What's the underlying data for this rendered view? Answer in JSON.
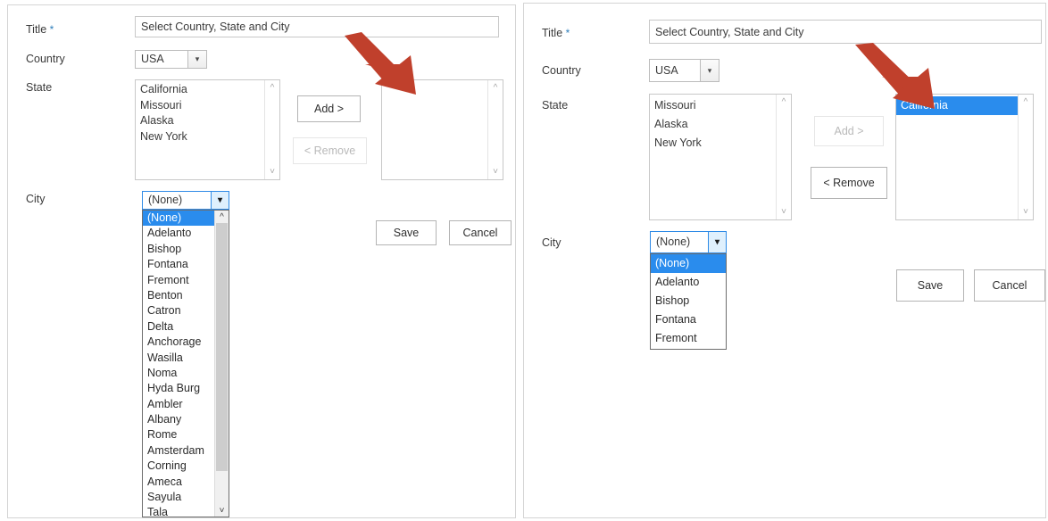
{
  "panels": [
    {
      "id": "before",
      "labels": {
        "title": "Title",
        "title_required_mark": "*",
        "country": "Country",
        "state": "State",
        "city": "City"
      },
      "title_input": {
        "value": "Select Country, State and City",
        "placeholder": "Select Country, State and City"
      },
      "country_select": {
        "value": "USA",
        "arrow_icon": "chevron-down-icon"
      },
      "state_available": {
        "items": [
          "California",
          "Missouri",
          "Alaska",
          "New York"
        ],
        "selected": null,
        "scroll_up_icon": "chevron-up-icon",
        "scroll_down_icon": "chevron-down-icon"
      },
      "state_selected": {
        "items": [],
        "selected": null,
        "scroll_up_icon": "chevron-up-icon",
        "scroll_down_icon": "chevron-down-icon"
      },
      "transfer_buttons": {
        "add_label": "Add >",
        "add_enabled": true,
        "remove_label": "< Remove",
        "remove_enabled": false
      },
      "city_select": {
        "value": "(None)",
        "arrow_icon": "chevron-down-icon",
        "open": true,
        "options": [
          "(None)",
          "Adelanto",
          "Bishop",
          "Fontana",
          "Fremont",
          "Benton",
          "Catron",
          "Delta",
          "Anchorage",
          "Wasilla",
          "Noma",
          "Hyda Burg",
          "Ambler",
          "Albany",
          "Rome",
          "Amsterdam",
          "Corning",
          "Ameca",
          "Sayula",
          "Tala"
        ],
        "selected_option": "(None)",
        "has_scrollbar": true
      },
      "actions": {
        "save_label": "Save",
        "cancel_label": "Cancel"
      },
      "annotation": {
        "arrow_color": "#c0402c",
        "points_to": "state-selected-listbox"
      }
    },
    {
      "id": "after",
      "labels": {
        "title": "Title",
        "title_required_mark": "*",
        "country": "Country",
        "state": "State",
        "city": "City"
      },
      "title_input": {
        "value": "Select Country, State and City",
        "placeholder": "Select Country, State and City"
      },
      "country_select": {
        "value": "USA",
        "arrow_icon": "chevron-down-icon"
      },
      "state_available": {
        "items": [
          "Missouri",
          "Alaska",
          "New York"
        ],
        "selected": null,
        "scroll_up_icon": "chevron-up-icon",
        "scroll_down_icon": "chevron-down-icon"
      },
      "state_selected": {
        "items": [
          "California"
        ],
        "selected": "California",
        "scroll_up_icon": "chevron-up-icon",
        "scroll_down_icon": "chevron-down-icon"
      },
      "transfer_buttons": {
        "add_label": "Add >",
        "add_enabled": false,
        "remove_label": "< Remove",
        "remove_enabled": true
      },
      "city_select": {
        "value": "(None)",
        "arrow_icon": "chevron-down-icon",
        "open": true,
        "options": [
          "(None)",
          "Adelanto",
          "Bishop",
          "Fontana",
          "Fremont"
        ],
        "selected_option": "(None)",
        "has_scrollbar": false
      },
      "actions": {
        "save_label": "Save",
        "cancel_label": "Cancel"
      },
      "annotation": {
        "arrow_color": "#c0402c",
        "points_to": "state-selected-listbox-california"
      }
    }
  ],
  "colors": {
    "highlight_blue": "#2a8ced",
    "annotation_red": "#c0402c",
    "required_star": "#2e7ebb",
    "panel_border": "#d4d4d4"
  }
}
